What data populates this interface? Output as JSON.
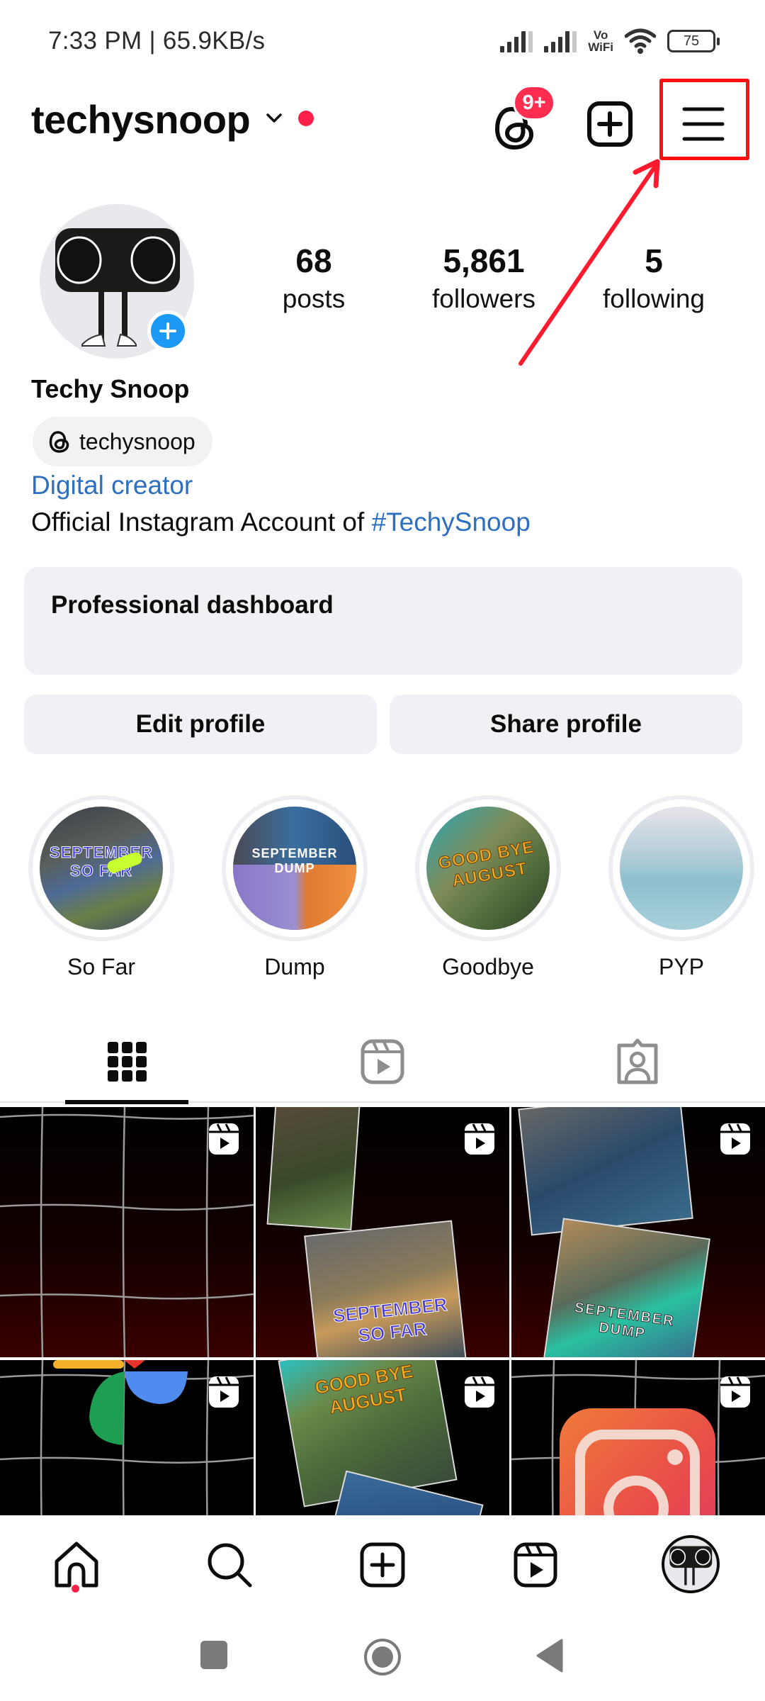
{
  "status_bar": {
    "time_speed": "7:33 PM | 65.9KB/s",
    "vowifi_line1": "Vo",
    "vowifi_line2": "WiFi",
    "battery": "75"
  },
  "header": {
    "username": "techysnoop",
    "threads_badge": "9+",
    "icons": [
      "chevron-down-icon",
      "threads-icon",
      "create-plus-icon",
      "hamburger-menu-icon"
    ],
    "accent_color": "#ff1f4b"
  },
  "annotation": {
    "highlight_color": "#ff1010",
    "target": "menu-button"
  },
  "profile": {
    "stats": [
      {
        "value": "68",
        "label": "posts"
      },
      {
        "value": "5,861",
        "label": "followers"
      },
      {
        "value": "5",
        "label": "following"
      }
    ],
    "full_name": "Techy Snoop",
    "threads_handle": "techysnoop",
    "category": "Digital creator",
    "bio_prefix": "Official Instagram Account of ",
    "bio_hashtag": "#TechySnoop",
    "link_color": "#2d6fc1"
  },
  "dashboard": {
    "title": "Professional dashboard"
  },
  "buttons": {
    "edit_profile": "Edit profile",
    "share_profile": "Share profile"
  },
  "highlights": [
    {
      "label": "So Far",
      "cover_text": "SEPTEMBER SO FAR"
    },
    {
      "label": "Dump",
      "cover_text": "SEPTEMBER DUMP"
    },
    {
      "label": "Goodbye",
      "cover_text": "GOOD BYE AUGUST"
    },
    {
      "label": "PYP",
      "cover_text": ""
    }
  ],
  "tabs": [
    {
      "name": "posts-grid",
      "icon": "grid-icon",
      "active": true
    },
    {
      "name": "reels",
      "icon": "reels-icon",
      "active": false
    },
    {
      "name": "tagged",
      "icon": "tagged-person-icon",
      "active": false
    }
  ],
  "grid_posts": [
    {
      "type": "reel",
      "overlay_text": ""
    },
    {
      "type": "reel",
      "overlay_text": "SEPTEMBER SO FAR"
    },
    {
      "type": "reel",
      "overlay_text": "SEPTEMBER DUMP"
    },
    {
      "type": "reel",
      "overlay_text": ""
    },
    {
      "type": "reel",
      "overlay_text": "GOOD BYE AUGUST"
    },
    {
      "type": "reel",
      "overlay_text": ""
    }
  ],
  "bottom_nav": [
    "home-icon",
    "search-icon",
    "create-icon",
    "reels-icon",
    "profile-avatar"
  ],
  "system_nav": [
    "recents-button",
    "home-button",
    "back-button"
  ]
}
